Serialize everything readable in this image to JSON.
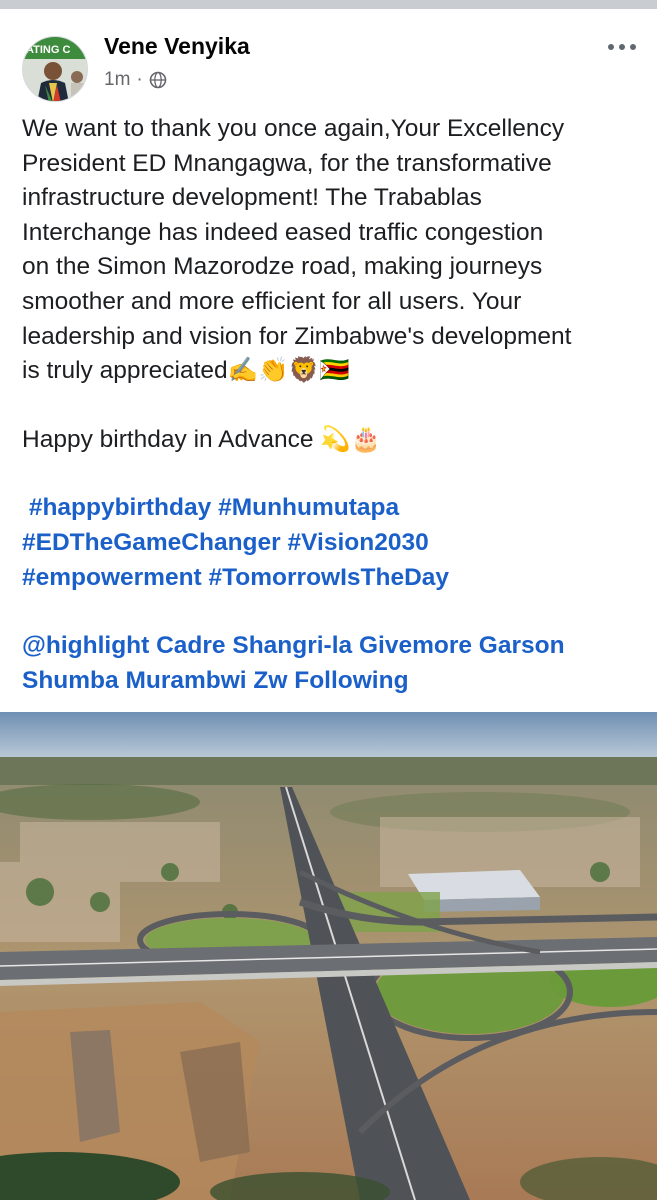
{
  "post": {
    "author": "Vene Venyika",
    "time": "1m",
    "separator": "·",
    "privacy_icon": "globe-icon",
    "avatar_banner": "ATING C",
    "more_icon": "more-horizontal-icon",
    "text_lines": [
      "We want to thank you once again,Your Excellency",
      "President ED Mnangagwa, for the transformative",
      "infrastructure development! The Trabablas",
      "Interchange has indeed eased traffic congestion",
      "on the Simon Mazorodze road, making journeys",
      "smoother and more efficient for all users. Your",
      "leadership and vision for Zimbabwe's development",
      "is truly appreciated✍️👏🦁🇿🇼"
    ],
    "birthday_line": "Happy birthday in Advance 💫🎂",
    "hashtag_lines": [
      [
        "#happybirthday",
        "#Munhumutapa"
      ],
      [
        "#EDTheGameChanger",
        "#Vision2030"
      ],
      [
        "#empowerment",
        "#TomorrowIsTheDay"
      ]
    ],
    "mention_lines": [
      "@highlight Cadre Shangri-la Givemore Garson",
      "Shumba Murambwi Zw Following"
    ]
  }
}
